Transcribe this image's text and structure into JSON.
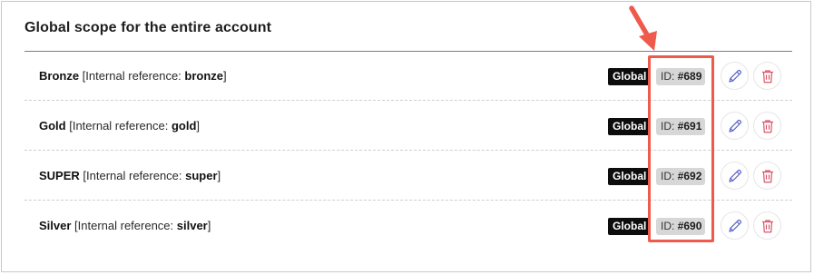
{
  "section": {
    "title": "Global scope for the entire account"
  },
  "rows": [
    {
      "name": "Bronze",
      "ref_prefix": " [Internal reference: ",
      "ref": "bronze",
      "ref_suffix": "]",
      "scope": "Global",
      "id_prefix": "ID: ",
      "id": "#689"
    },
    {
      "name": "Gold",
      "ref_prefix": " [Internal reference: ",
      "ref": "gold",
      "ref_suffix": "]",
      "scope": "Global",
      "id_prefix": "ID: ",
      "id": "#691"
    },
    {
      "name": "SUPER",
      "ref_prefix": " [Internal reference: ",
      "ref": "super",
      "ref_suffix": "]",
      "scope": "Global",
      "id_prefix": "ID: ",
      "id": "#692"
    },
    {
      "name": "Silver",
      "ref_prefix": " [Internal reference: ",
      "ref": "silver",
      "ref_suffix": "]",
      "scope": "Global",
      "id_prefix": "ID: ",
      "id": "#690"
    }
  ],
  "icons": {
    "edit": "pencil-icon",
    "delete": "trash-icon",
    "annotation": "arrow-icon"
  },
  "colors": {
    "highlight": "#ee5a4c",
    "edit_icon": "#5a63c8",
    "delete_icon": "#d9546a",
    "global_badge_bg": "#0d0d0d",
    "id_badge_bg": "#d7d7d7"
  }
}
